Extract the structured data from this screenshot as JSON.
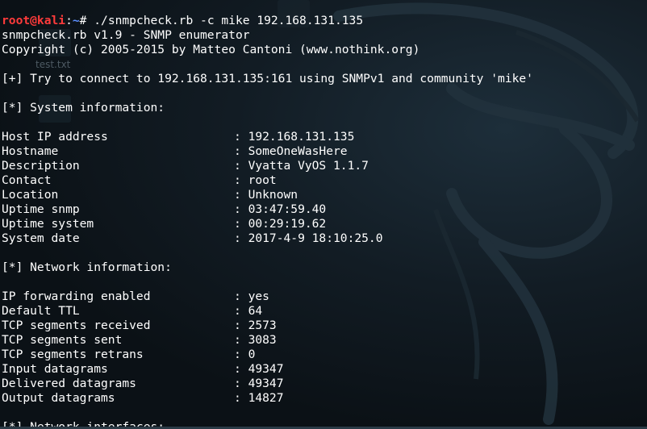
{
  "prompt": {
    "user": "root@kali",
    "separator": ":",
    "path": "~",
    "symbol": "# ",
    "command": "./snmpcheck.rb -c mike 192.168.131.135"
  },
  "banner": {
    "line1": "snmpcheck.rb v1.9 - SNMP enumerator",
    "line2": "Copyright (c) 2005-2015 by Matteo Cantoni (www.nothink.org)"
  },
  "connect_line": "[+] Try to connect to 192.168.131.135:161 using SNMPv1 and community 'mike'",
  "system_section": {
    "header": "[*] System information:",
    "rows": [
      {
        "key": "Host IP address",
        "value": ": 192.168.131.135"
      },
      {
        "key": "Hostname",
        "value": ": SomeOneWasHere"
      },
      {
        "key": "Description",
        "value": ": Vyatta VyOS 1.1.7"
      },
      {
        "key": "Contact",
        "value": ": root"
      },
      {
        "key": "Location",
        "value": ": Unknown"
      },
      {
        "key": "Uptime snmp",
        "value": ": 03:47:59.40"
      },
      {
        "key": "Uptime system",
        "value": ": 00:29:19.62"
      },
      {
        "key": "System date",
        "value": ": 2017-4-9 18:10:25.0"
      }
    ]
  },
  "network_section": {
    "header": "[*] Network information:",
    "rows": [
      {
        "key": "IP forwarding enabled",
        "value": ": yes"
      },
      {
        "key": "Default TTL",
        "value": ": 64"
      },
      {
        "key": "TCP segments received",
        "value": ": 2573"
      },
      {
        "key": "TCP segments sent",
        "value": ": 3083"
      },
      {
        "key": "TCP segments retrans",
        "value": ": 0"
      },
      {
        "key": "Input datagrams",
        "value": ": 49347"
      },
      {
        "key": "Delivered datagrams",
        "value": ": 49347"
      },
      {
        "key": "Output datagrams",
        "value": ": 14827"
      }
    ]
  },
  "next_section_header": "[*] Network interfaces:",
  "desktop": {
    "file_label": "test.txt"
  },
  "colors": {
    "prompt_user": "#ff3b3b",
    "prompt_path": "#5c8fff",
    "text": "#ffffff",
    "background": "#0b1116"
  }
}
